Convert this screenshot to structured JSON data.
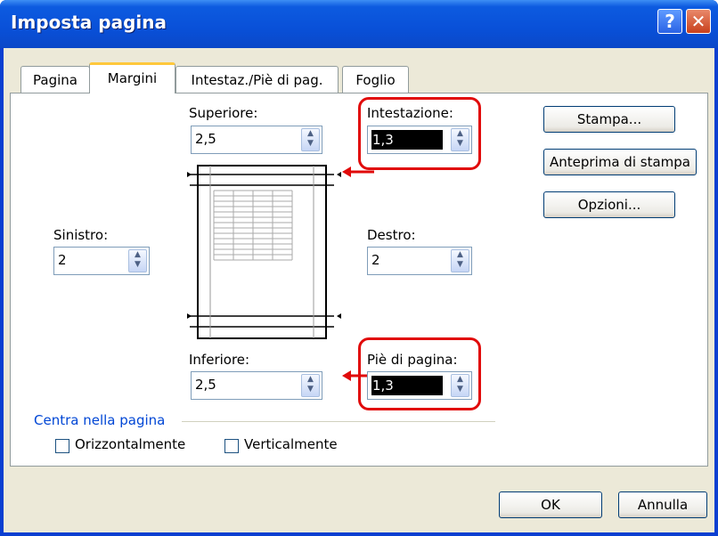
{
  "window": {
    "title": "Imposta pagina",
    "help": "?",
    "close": "✕"
  },
  "tabs": [
    {
      "label": "Pagina"
    },
    {
      "label": "Margini"
    },
    {
      "label": "Intestaz./Piè di pag."
    },
    {
      "label": "Foglio"
    }
  ],
  "margins": {
    "top": {
      "label": "Superiore:",
      "value": "2,5"
    },
    "header": {
      "label": "Intestazione:",
      "value": "1,3"
    },
    "left": {
      "label": "Sinistro:",
      "value": "2"
    },
    "right": {
      "label": "Destro:",
      "value": "2"
    },
    "bottom": {
      "label": "Inferiore:",
      "value": "2,5"
    },
    "footer": {
      "label": "Piè di pagina:",
      "value": "1,3"
    }
  },
  "center": {
    "title": "Centra nella pagina",
    "horizontal": {
      "label": "Orizzontalmente",
      "checked": false
    },
    "vertical": {
      "label": "Verticalmente",
      "checked": false
    }
  },
  "side_buttons": {
    "print": "Stampa...",
    "preview": "Anteprima di stampa",
    "options": "Opzioni..."
  },
  "footer_buttons": {
    "ok": "OK",
    "cancel": "Annulla"
  },
  "colors": {
    "title_bar": "#0a50d8",
    "dialog_bg": "#ece9d8",
    "highlight": "#e10a0a",
    "active_tab": "#ffc83c"
  }
}
